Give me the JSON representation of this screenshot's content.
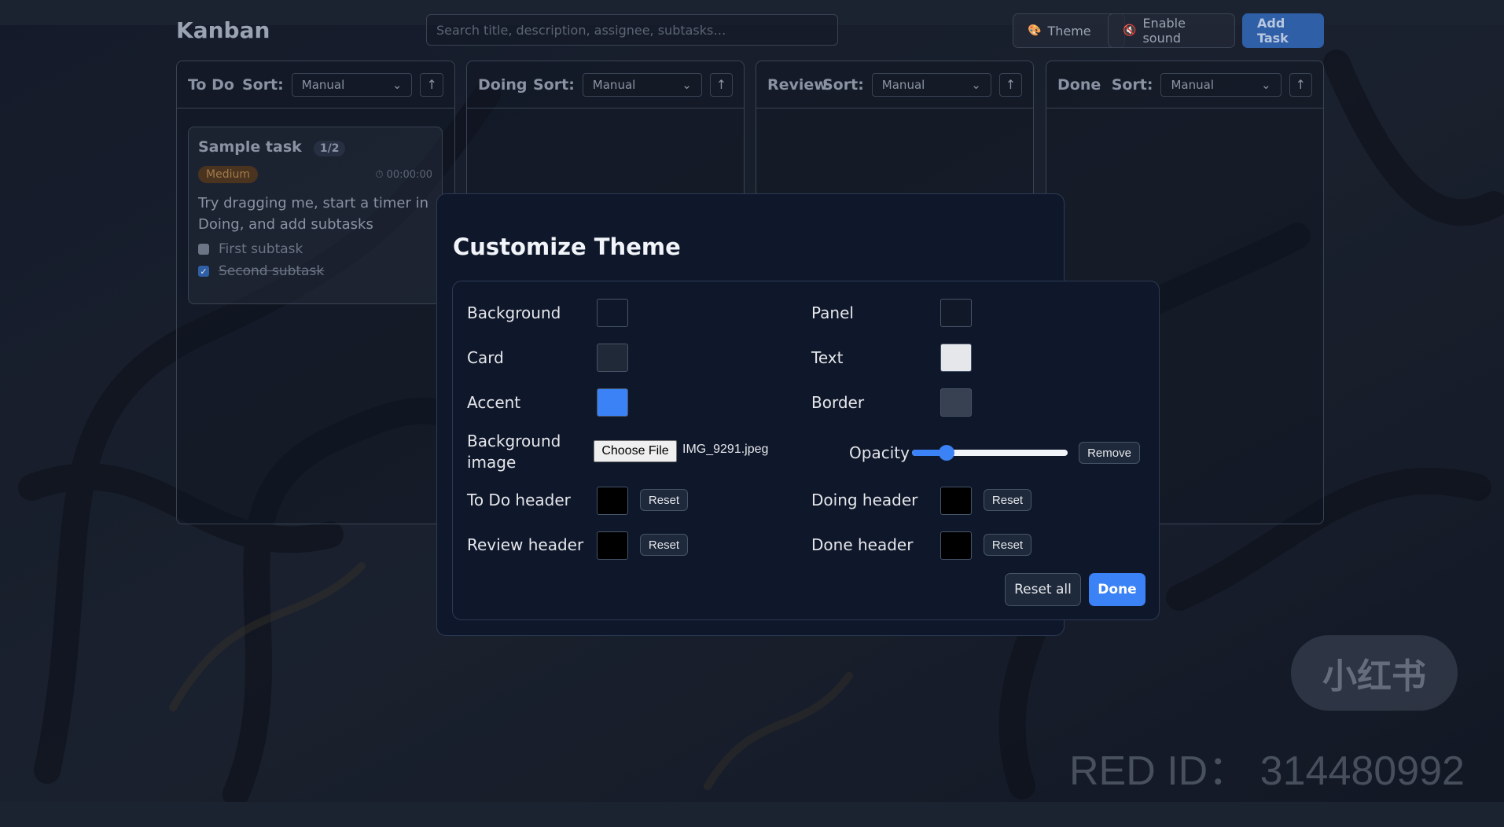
{
  "app": {
    "title": "Kanban",
    "search_placeholder": "Search title, description, assignee, subtasks…",
    "theme_button": "Theme",
    "sound_button": "Enable sound",
    "add_task_button": "Add Task"
  },
  "columns": [
    {
      "title": "To Do",
      "sort_label": "Sort:",
      "sort_value": "Manual",
      "direction": "↑"
    },
    {
      "title": "Doing",
      "sort_label": "Sort:",
      "sort_value": "Manual",
      "direction": "↑"
    },
    {
      "title": "Review",
      "sort_label": "Sort:",
      "sort_value": "Manual",
      "direction": "↑"
    },
    {
      "title": "Done",
      "sort_label": "Sort:",
      "sort_value": "Manual",
      "direction": "↑"
    }
  ],
  "card": {
    "title": "Sample task",
    "subtask_count": "1/2",
    "priority": "Medium",
    "timer": "00:00:00",
    "description": "Try dragging me, start a timer in Doing, and add subtasks",
    "subtasks": [
      {
        "label": "First subtask",
        "done": false
      },
      {
        "label": "Second subtask",
        "done": true
      }
    ]
  },
  "watermark": {
    "logo": "小红书",
    "id": "RED ID： 314480992"
  },
  "dialog": {
    "title": "Customize Theme",
    "background_label": "Background",
    "panel_label": "Panel",
    "card_label": "Card",
    "text_label": "Text",
    "accent_label": "Accent",
    "border_label": "Border",
    "bg_image_label": "Background image",
    "choose_file": "Choose File",
    "file_name": "IMG_9291.jpeg",
    "opacity_label": "Opacity",
    "opacity_value": 0.22,
    "remove_button": "Remove",
    "todo_header_label": "To Do header",
    "doing_header_label": "Doing header",
    "review_header_label": "Review header",
    "done_header_label": "Done header",
    "reset_label": "Reset",
    "reset_all": "Reset all",
    "done_button": "Done",
    "colors": {
      "background": "#0f172a",
      "panel": "#111827",
      "card": "#1f2937",
      "text": "#e5e7eb",
      "accent": "#3b82f6",
      "border": "#374151",
      "todo_header": "#000000",
      "doing_header": "#000000",
      "review_header": "#000000",
      "done_header": "#000000"
    }
  }
}
